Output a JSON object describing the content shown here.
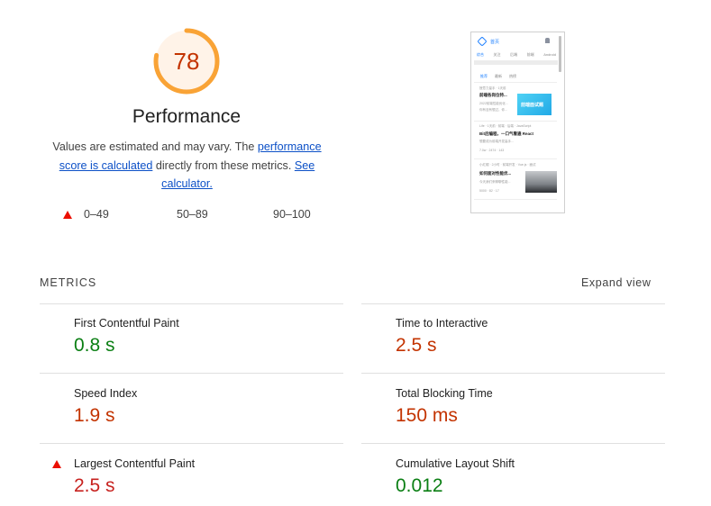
{
  "performance": {
    "score": "78",
    "score_fraction": 0.78,
    "title": "Performance",
    "desc_part1": "Values are estimated and may vary. The ",
    "desc_link1": "performance score is calculated",
    "desc_part2": " directly from these metrics. ",
    "desc_link2": "See calculator.",
    "gauge_color": "#f9a336",
    "gauge_fill": "#fff3e8",
    "score_color": "#c33300"
  },
  "legend": {
    "fail": "0–49",
    "average": "50–89",
    "pass": "90–100"
  },
  "thumbnail": {
    "nav_home": "首页",
    "tabs": [
      "综合",
      "关注",
      "后端",
      "前端",
      "Android"
    ],
    "subtabs": [
      "推荐",
      "最新",
      "热榜"
    ],
    "articles": [
      {
        "meta": "授意力量手 · 1天前",
        "title": "前端各岗位特...",
        "line": "2022前端性能优化...",
        "line2": "你有没有想过，你...",
        "img_text": "前端面试题"
      },
      {
        "meta": "Life · 1天前 · 前端 · 后端 · JavaScript",
        "title": "Bit后编程，一口气看遍 React",
        "line": "想要成为前端开发高手...",
        "line2": "7.0w · 2474 · 143"
      },
      {
        "meta": "小红帽 · 2小时 · 前端开发 · Vue.js · 面试",
        "title": "如何面对性能优...",
        "line": "今天我们来聊聊性能...",
        "line2": "5000 · 82 · 17"
      }
    ]
  },
  "metrics": {
    "title": "METRICS",
    "expand": "Expand view",
    "items": [
      {
        "name": "First Contentful Paint",
        "value": "0.8 s",
        "rating": "pass"
      },
      {
        "name": "Time to Interactive",
        "value": "2.5 s",
        "rating": "average"
      },
      {
        "name": "Speed Index",
        "value": "1.9 s",
        "rating": "average"
      },
      {
        "name": "Total Blocking Time",
        "value": "150 ms",
        "rating": "average"
      },
      {
        "name": "Largest Contentful Paint",
        "value": "2.5 s",
        "rating": "fail"
      },
      {
        "name": "Cumulative Layout Shift",
        "value": "0.012",
        "rating": "pass"
      }
    ]
  }
}
